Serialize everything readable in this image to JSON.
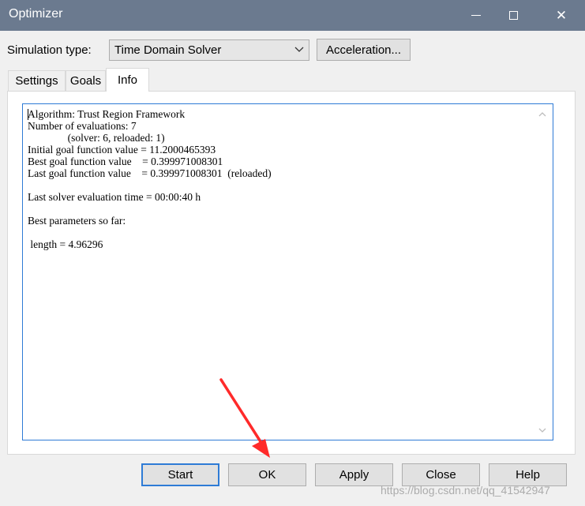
{
  "window": {
    "title": "Optimizer",
    "controls": {
      "minimize": "minimize-icon",
      "maximize": "maximize-icon",
      "close": "✕"
    }
  },
  "simulation": {
    "label": "Simulation type:",
    "selected": "Time Domain Solver",
    "acceleration_label": "Acceleration..."
  },
  "tabs": [
    {
      "label": "Settings",
      "active": false
    },
    {
      "label": "Goals",
      "active": false
    },
    {
      "label": "Info",
      "active": true
    }
  ],
  "info": {
    "lines": [
      "Algorithm: Trust Region Framework",
      "Number of evaluations: 7",
      "               (solver: 6, reloaded: 1)",
      "Initial goal function value = 11.2000465393",
      "Best goal function value    = 0.399971008301",
      "Last goal function value    = 0.399971008301  (reloaded)",
      "",
      "Last solver evaluation time = 00:00:40 h",
      "",
      "Best parameters so far:",
      "",
      " length = 4.96296"
    ]
  },
  "buttons": {
    "start": "Start",
    "ok": "OK",
    "apply": "Apply",
    "close": "Close",
    "help": "Help"
  },
  "watermark": "https://blog.csdn.net/qq_41542947",
  "colors": {
    "titlebar": "#6b7a8f",
    "focus_border": "#2e7bd6",
    "annotation_arrow": "#ff2a2a"
  }
}
